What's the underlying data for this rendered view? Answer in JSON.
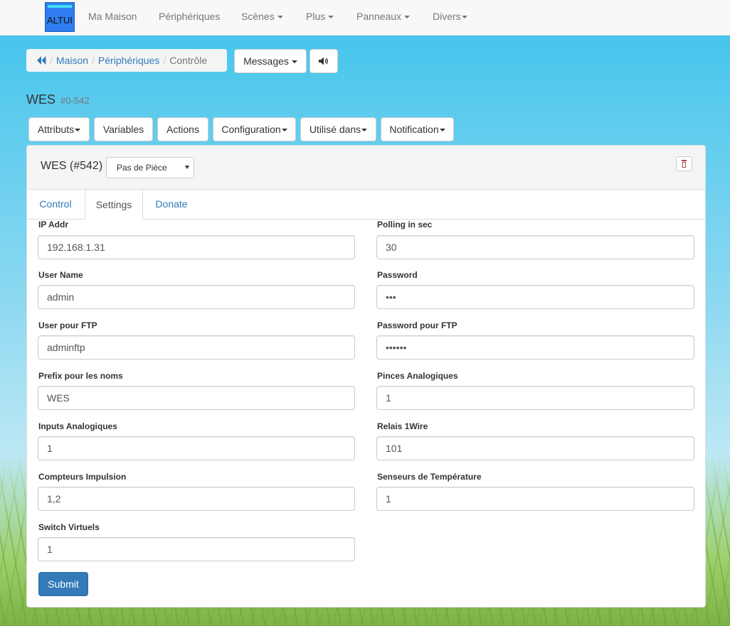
{
  "navbar": {
    "brand": "ALTUI",
    "items": [
      {
        "label": "Ma Maison"
      },
      {
        "label": "Périphériques"
      },
      {
        "label": "Scènes"
      },
      {
        "label": "Plus"
      },
      {
        "label": "Panneaux"
      },
      {
        "label": "Divers"
      }
    ]
  },
  "breadcrumb": {
    "back_icon": "double-chevron-left-icon",
    "items": [
      "Maison",
      "Périphériques",
      "Contrôle"
    ]
  },
  "toolbar": {
    "messages": "Messages",
    "sound_icon": "speaker-icon"
  },
  "page": {
    "title": "WES",
    "subtitle": "#0-542"
  },
  "actions": [
    "Attributs",
    "Variables",
    "Actions",
    "Configuration",
    "Utilisé dans",
    "Notification"
  ],
  "device": {
    "name": "WES (#542)",
    "room": "Pas de Pièce",
    "delete_icon": "trash-icon"
  },
  "tabs": [
    "Control",
    "Settings",
    "Donate"
  ],
  "form": {
    "left": [
      {
        "label": "IP Addr",
        "value": "192.168.1.31"
      },
      {
        "label": "User Name",
        "value": "admin"
      },
      {
        "label": "User pour FTP",
        "value": "adminftp"
      },
      {
        "label": "Prefix pour les noms",
        "value": "WES"
      },
      {
        "label": "Inputs Analogiques",
        "value": "1"
      },
      {
        "label": "Compteurs Impulsion",
        "value": "1,2"
      },
      {
        "label": "Switch Virtuels",
        "value": "1"
      }
    ],
    "right": [
      {
        "label": "Polling in sec",
        "value": "30"
      },
      {
        "label": "Password",
        "value": "•••"
      },
      {
        "label": "Password pour FTP",
        "value": "••••••"
      },
      {
        "label": "Pinces Analogiques",
        "value": "1"
      },
      {
        "label": "Relais 1Wire",
        "value": "101"
      },
      {
        "label": "Senseurs de Température",
        "value": "1"
      }
    ],
    "submit": "Submit"
  },
  "colors": {
    "primary": "#337ab7",
    "link": "#337ab7",
    "brand_bg": "#2f7df0"
  }
}
